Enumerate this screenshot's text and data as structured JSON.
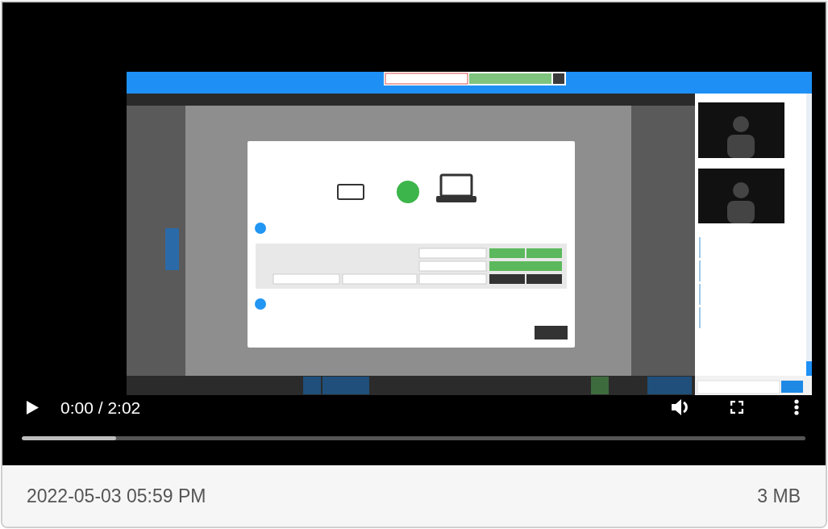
{
  "player": {
    "playing": false,
    "time": "0:00 / 2:02",
    "seek_bar": {
      "level": 0.12
    }
  },
  "file": {
    "date": "2022-05-03 05:59 PM",
    "size": "3 MB"
  }
}
